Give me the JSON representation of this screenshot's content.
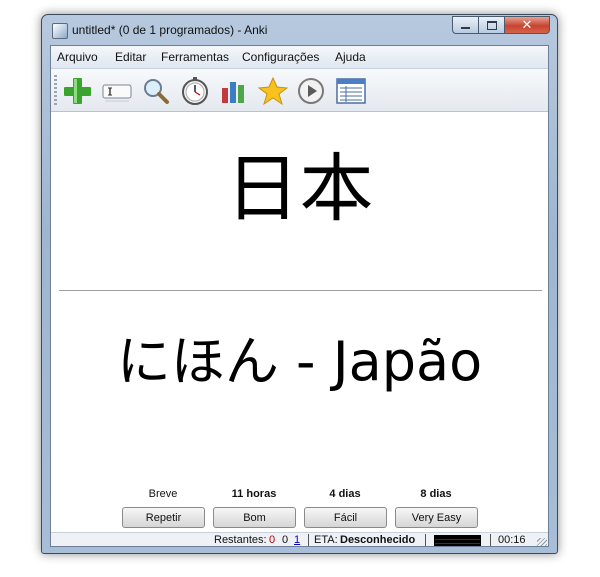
{
  "window": {
    "title": "untitled* (0 de 1 programados) - Anki",
    "minimize_icon": "minimize-icon",
    "maximize_icon": "maximize-icon",
    "close_glyph": "✕"
  },
  "menubar": {
    "items": [
      "Arquivo",
      "Editar",
      "Ferramentas",
      "Configurações",
      "Ajuda"
    ]
  },
  "toolbar": {
    "icons": [
      "add-icon",
      "edit-field-icon",
      "search-icon",
      "timer-icon",
      "graph-icon",
      "star-icon",
      "play-icon",
      "card-list-icon"
    ]
  },
  "card": {
    "question": "日本",
    "answer": "にほん - Japão"
  },
  "answers": {
    "intervals": [
      "Breve",
      "11 horas",
      "4 dias",
      "8 dias"
    ],
    "buttons": [
      "Repetir",
      "Bom",
      "Fácil",
      "Very Easy"
    ]
  },
  "status": {
    "remaining_label": "Restantes:",
    "remaining_red": "0",
    "remaining_black": "0",
    "remaining_blue": "1",
    "eta_label": "ETA:",
    "eta_value": "Desconhecido",
    "time": "00:16"
  },
  "colors": {
    "red_count": "#c00000",
    "blue_count": "#0000c8",
    "title_bar": "#a8bdd6"
  }
}
